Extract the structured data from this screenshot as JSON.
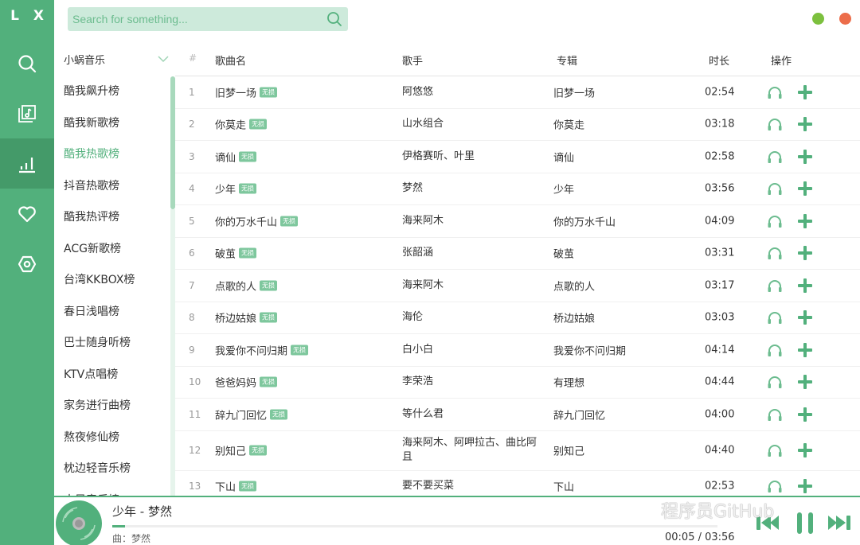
{
  "app": {
    "logo": "L X",
    "colors": {
      "accent": "#52b07c",
      "accent_dark": "#449a69",
      "min_dot": "#7cc03e",
      "close_dot": "#ec6d4a"
    }
  },
  "nav": {
    "items": [
      {
        "name": "search",
        "icon": "search-icon",
        "active": false
      },
      {
        "name": "song-list",
        "icon": "music-folder-icon",
        "active": false
      },
      {
        "name": "leaderboard",
        "icon": "bar-chart-icon",
        "active": true
      },
      {
        "name": "favorites",
        "icon": "heart-icon",
        "active": false
      },
      {
        "name": "settings",
        "icon": "settings-hexagon-icon",
        "active": false
      }
    ]
  },
  "search": {
    "placeholder": "Search for something...",
    "value": ""
  },
  "source": {
    "selected": "小蜗音乐"
  },
  "boards": {
    "active_index": 2,
    "items": [
      "酷我飙升榜",
      "酷我新歌榜",
      "酷我热歌榜",
      "抖音热歌榜",
      "酷我热评榜",
      "ACG新歌榜",
      "台湾KKBOX榜",
      "春日浅唱榜",
      "巴士随身听榜",
      "KTV点唱榜",
      "家务进行曲榜",
      "熬夜修仙榜",
      "枕边轻音乐榜",
      "古风音乐榜"
    ]
  },
  "table": {
    "headers": {
      "num": "#",
      "name": "歌曲名",
      "singer": "歌手",
      "album": "专辑",
      "duration": "时长",
      "actions": "操作"
    },
    "badge": "无损",
    "rows": [
      {
        "num": "1",
        "name": "旧梦一场",
        "singer": "阿悠悠",
        "album": "旧梦一场",
        "duration": "02:54"
      },
      {
        "num": "2",
        "name": "你莫走",
        "singer": "山水组合",
        "album": "你莫走",
        "duration": "03:18"
      },
      {
        "num": "3",
        "name": "谪仙",
        "singer": "伊格赛听、叶里",
        "album": "谪仙",
        "duration": "02:58"
      },
      {
        "num": "4",
        "name": "少年",
        "singer": "梦然",
        "album": "少年",
        "duration": "03:56"
      },
      {
        "num": "5",
        "name": "你的万水千山",
        "singer": "海来阿木",
        "album": "你的万水千山",
        "duration": "04:09"
      },
      {
        "num": "6",
        "name": "破茧",
        "singer": "张韶涵",
        "album": "破茧",
        "duration": "03:31"
      },
      {
        "num": "7",
        "name": "点歌的人",
        "singer": "海来阿木",
        "album": "点歌的人",
        "duration": "03:17"
      },
      {
        "num": "8",
        "name": "桥边姑娘",
        "singer": "海伦",
        "album": "桥边姑娘",
        "duration": "03:03"
      },
      {
        "num": "9",
        "name": "我爱你不问归期",
        "singer": "白小白",
        "album": "我爱你不问归期",
        "duration": "04:14"
      },
      {
        "num": "10",
        "name": "爸爸妈妈",
        "singer": "李荣浩",
        "album": "有理想",
        "duration": "04:44"
      },
      {
        "num": "11",
        "name": "辞九门回忆",
        "singer": "等什么君",
        "album": "辞九门回忆",
        "duration": "04:00"
      },
      {
        "num": "12",
        "name": "别知己",
        "singer": "海来阿木、阿呷拉古、曲比阿且",
        "album": "别知己",
        "duration": "04:40"
      },
      {
        "num": "13",
        "name": "下山",
        "singer": "要不要买菜",
        "album": "下山",
        "duration": "02:53"
      }
    ]
  },
  "player": {
    "title": "少年 - 梦然",
    "subtitle": "曲：梦然",
    "current_time": "00:05",
    "total_time": "03:56",
    "time_display": "00:05 / 03:56",
    "progress_fraction": 0.021,
    "watermark": "程序员GitHub"
  }
}
